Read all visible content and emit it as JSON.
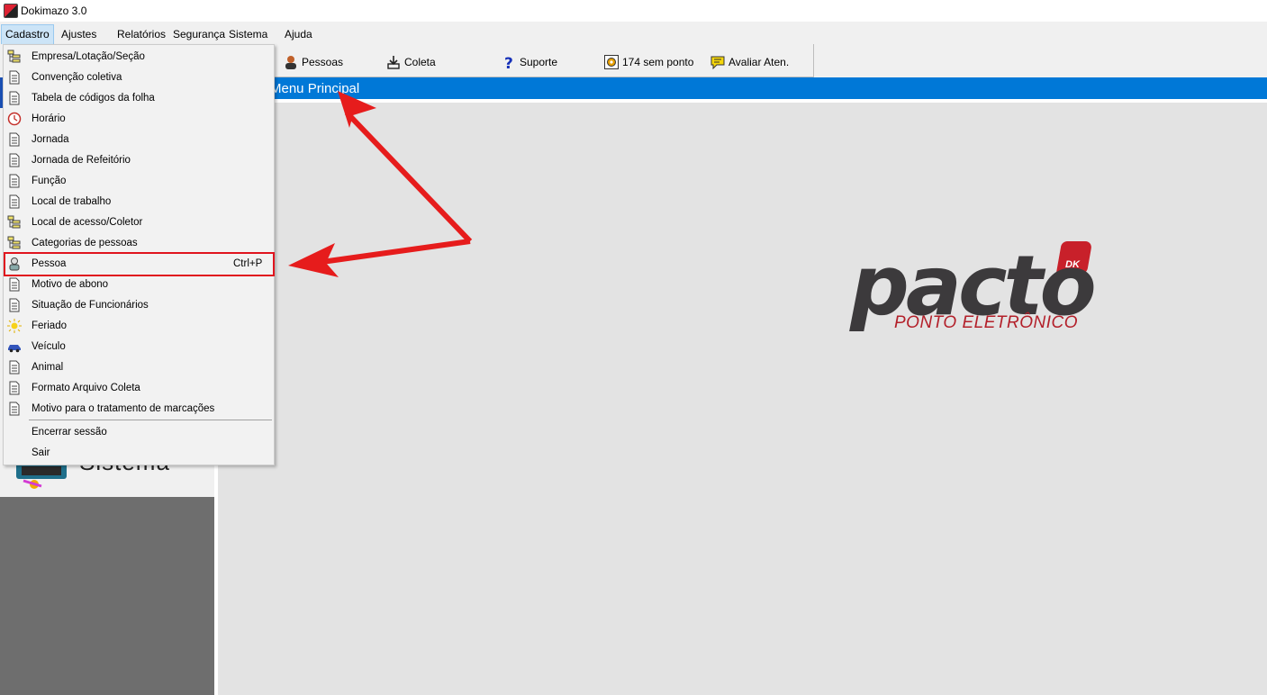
{
  "window": {
    "title": "Dokimazo 3.0"
  },
  "menubar": {
    "items": [
      "Cadastro",
      "Ajustes",
      "Relatórios",
      "Segurança",
      "Sistema",
      "Ajuda"
    ]
  },
  "toolbar": {
    "buttons": [
      {
        "label": "Pessoas",
        "icon": "person-icon"
      },
      {
        "label": "Coleta",
        "icon": "download-icon"
      },
      {
        "label": "Suporte",
        "icon": "question-icon"
      },
      {
        "label": "174 sem ponto",
        "icon": "gear-alert-icon"
      },
      {
        "label": "Avaliar Aten.",
        "icon": "chat-bubble-icon"
      }
    ]
  },
  "header": {
    "title": "Menu Principal"
  },
  "left_panel": {
    "label": "Sistema"
  },
  "logo": {
    "word": "pacto",
    "badge": "DK",
    "subtitle": "PONTO ELETRÔNICO"
  },
  "dropdown": {
    "items": [
      {
        "label": "Empresa/Lotação/Seção",
        "icon": "tree-icon"
      },
      {
        "label": "Convenção coletiva",
        "icon": "document-icon"
      },
      {
        "label": "Tabela de códigos da folha",
        "icon": "document-icon"
      },
      {
        "label": "Horário",
        "icon": "clock-icon"
      },
      {
        "label": "Jornada",
        "icon": "document-icon"
      },
      {
        "label": "Jornada de Refeitório",
        "icon": "document-icon"
      },
      {
        "label": "Função",
        "icon": "document-icon"
      },
      {
        "label": "Local de trabalho",
        "icon": "document-icon"
      },
      {
        "label": "Local de acesso/Coletor",
        "icon": "tree-icon"
      },
      {
        "label": "Categorias de pessoas",
        "icon": "tree-icon"
      },
      {
        "label": "Pessoa",
        "icon": "person-icon",
        "shortcut": "Ctrl+P"
      },
      {
        "label": "Motivo de abono",
        "icon": "document-icon"
      },
      {
        "label": "Situação de Funcionários",
        "icon": "document-icon"
      },
      {
        "label": "Feriado",
        "icon": "sun-icon"
      },
      {
        "label": "Veículo",
        "icon": "car-icon"
      },
      {
        "label": "Animal",
        "icon": "document-icon"
      },
      {
        "label": "Formato Arquivo Coleta",
        "icon": "document-icon"
      },
      {
        "label": "Motivo para o tratamento de marcações",
        "icon": "document-icon"
      },
      {
        "label": "Encerrar sessão"
      },
      {
        "label": "Sair"
      }
    ]
  },
  "colors": {
    "header_blue": "#0078d7",
    "highlight_red": "#e0141e",
    "logo_red": "#b3202a",
    "logo_gray": "#3c3a3c"
  }
}
